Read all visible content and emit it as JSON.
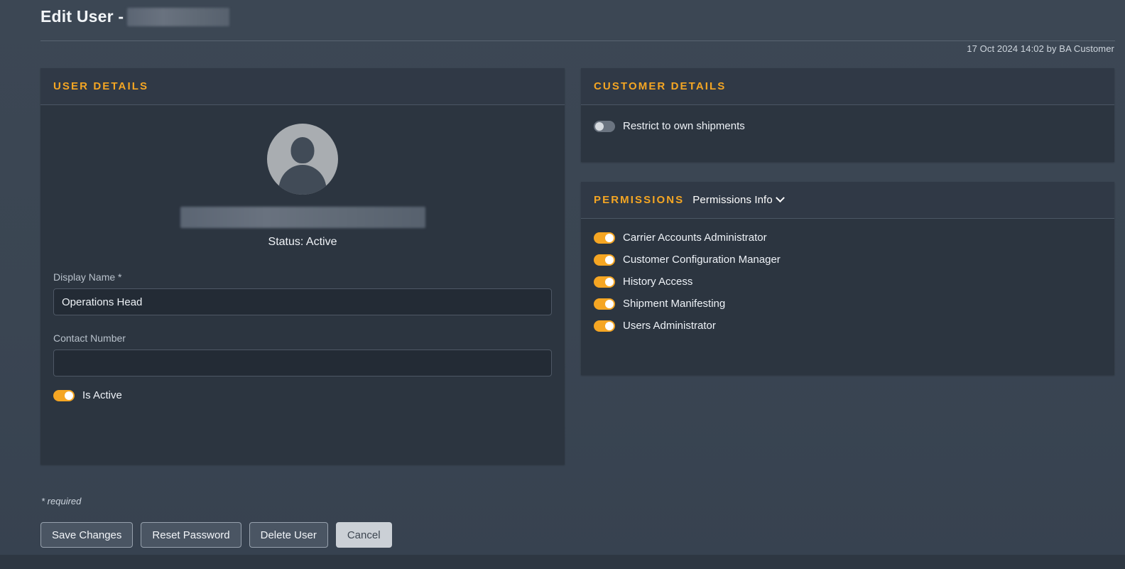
{
  "header": {
    "title_prefix": "Edit User -",
    "redacted_name": "",
    "meta": "17 Oct 2024 14:02 by BA Customer"
  },
  "user_details": {
    "panel_title": "USER DETAILS",
    "avatar_icon": "user-avatar-icon",
    "redacted_user_name": "",
    "status": "Status: Active",
    "display_name": {
      "label": "Display Name *",
      "value": "Operations Head",
      "placeholder": ""
    },
    "contact_number": {
      "label": "Contact Number",
      "value": "",
      "placeholder": ""
    },
    "is_active": {
      "label": "Is Active",
      "state": "on"
    }
  },
  "customer_details": {
    "panel_title": "CUSTOMER DETAILS",
    "restrict": {
      "label": "Restrict to own shipments",
      "state": "off"
    }
  },
  "permissions": {
    "panel_title": "PERMISSIONS",
    "info_link": "Permissions Info",
    "chevron_icon": "chevron-down-icon",
    "items": [
      {
        "label": "Carrier Accounts Administrator",
        "state": "on"
      },
      {
        "label": "Customer Configuration Manager",
        "state": "on"
      },
      {
        "label": "History Access",
        "state": "on"
      },
      {
        "label": "Shipment Manifesting",
        "state": "on"
      },
      {
        "label": "Users Administrator",
        "state": "on"
      }
    ]
  },
  "footer": {
    "required_note": "* required",
    "buttons": [
      {
        "label": "Save Changes",
        "style": "primary"
      },
      {
        "label": "Reset Password",
        "style": "primary"
      },
      {
        "label": "Delete User",
        "style": "primary"
      },
      {
        "label": "Cancel",
        "style": "secondary"
      }
    ]
  },
  "colors": {
    "accent": "#f5a623",
    "page_bg": "#3b4654",
    "panel_bg": "#2c3540",
    "panel_head_bg": "#303946",
    "input_bg": "#232b35",
    "text": "#eef2f7"
  }
}
